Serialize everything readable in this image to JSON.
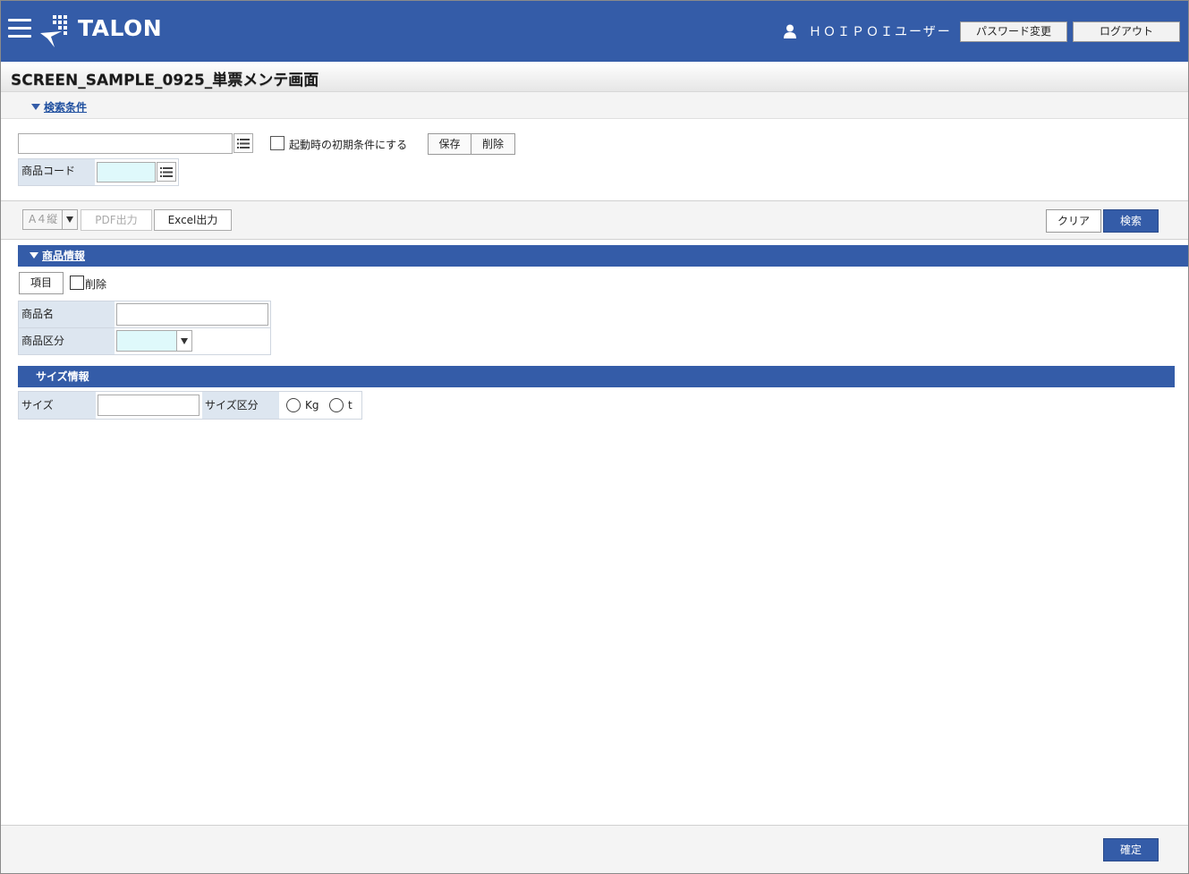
{
  "header": {
    "logo_text": "TALON",
    "user_name": "ＨＯＩＰＯＩユーザー",
    "password_change_label": "パスワード変更",
    "logout_label": "ログアウト"
  },
  "page": {
    "title": "SCREEN_SAMPLE_0925_単票メンテ画面"
  },
  "search": {
    "toggle_label": "検索条件",
    "condition_value": "",
    "startup_default_label": "起動時の初期条件にする",
    "save_label": "保存",
    "delete_label": "削除",
    "product_code_label": "商品コード",
    "product_code_value": ""
  },
  "toolbar": {
    "paper_select": "A４縦",
    "pdf_label": "PDF出力",
    "excel_label": "Excel出力",
    "clear_label": "クリア",
    "search_label": "検索"
  },
  "product_section": {
    "title": "商品情報",
    "item_button": "項目",
    "delete_checkbox_label": "削除",
    "name_label": "商品名",
    "name_value": "",
    "category_label": "商品区分",
    "category_value": ""
  },
  "size_section": {
    "title": "サイズ情報",
    "size_label": "サイズ",
    "size_value": "",
    "size_unit_label": "サイズ区分",
    "unit_options": [
      "Kg",
      "t"
    ]
  },
  "footer": {
    "confirm_label": "確定"
  },
  "colors": {
    "brand": "#345ca8",
    "label_bg": "#dde6f0",
    "required_input_bg": "#dff9fb"
  }
}
